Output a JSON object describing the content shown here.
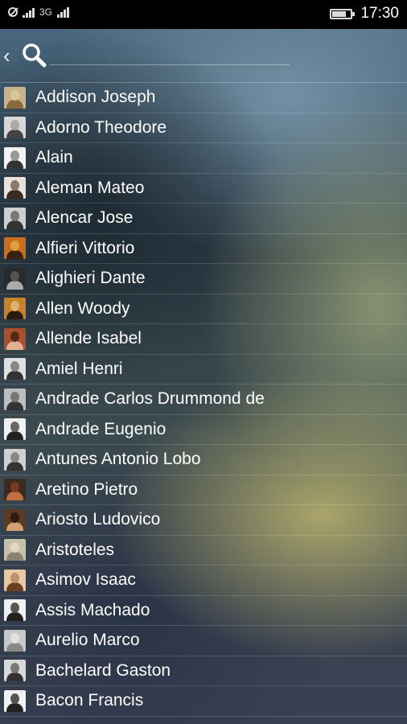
{
  "statusbar": {
    "network": "3G",
    "time": "17:30",
    "icons": [
      "no-sim-icon",
      "signal-icon",
      "network-3g-icon",
      "battery-icon"
    ]
  },
  "search": {
    "value": "",
    "placeholder": "",
    "icons": [
      "back-arrow-icon",
      "search-icon"
    ]
  },
  "list": {
    "items": [
      {
        "name": "Addison Joseph",
        "avatar_colors": [
          "#c9b38a",
          "#8a6a3a",
          "#d9c79c"
        ]
      },
      {
        "name": "Adorno Theodore",
        "avatar_colors": [
          "#d8d8d8",
          "#444444",
          "#aaaaaa"
        ]
      },
      {
        "name": "Alain",
        "avatar_colors": [
          "#f2f2f2",
          "#333333",
          "#999999"
        ]
      },
      {
        "name": "Aleman Mateo",
        "avatar_colors": [
          "#e8e2d8",
          "#3a2a20",
          "#8a7a6a"
        ]
      },
      {
        "name": "Alencar Jose",
        "avatar_colors": [
          "#cfcfcf",
          "#333333",
          "#777777"
        ]
      },
      {
        "name": "Alfieri Vittorio",
        "avatar_colors": [
          "#c8701e",
          "#3a2010",
          "#e0a040"
        ]
      },
      {
        "name": "Alighieri Dante",
        "avatar_colors": [
          "#2a2a2a",
          "#aaaaaa",
          "#555555"
        ]
      },
      {
        "name": "Allen Woody",
        "avatar_colors": [
          "#c8822a",
          "#2a1a10",
          "#e0b070"
        ]
      },
      {
        "name": "Allende Isabel",
        "avatar_colors": [
          "#a85030",
          "#e0b090",
          "#5a2a18"
        ]
      },
      {
        "name": "Amiel Henri",
        "avatar_colors": [
          "#e0e0e0",
          "#333333",
          "#888888"
        ]
      },
      {
        "name": "Andrade Carlos Drummond de",
        "avatar_colors": [
          "#bdbdbd",
          "#333333",
          "#777777"
        ]
      },
      {
        "name": "Andrade Eugenio",
        "avatar_colors": [
          "#f0f0f0",
          "#222222",
          "#666666"
        ]
      },
      {
        "name": "Antunes Antonio Lobo",
        "avatar_colors": [
          "#d0d0d0",
          "#333333",
          "#888888"
        ]
      },
      {
        "name": "Aretino Pietro",
        "avatar_colors": [
          "#3a2a20",
          "#c07040",
          "#7a3a20"
        ]
      },
      {
        "name": "Ariosto Ludovico",
        "avatar_colors": [
          "#5a3a20",
          "#d0a070",
          "#2a1a10"
        ]
      },
      {
        "name": "Aristoteles",
        "avatar_colors": [
          "#c8c0a8",
          "#8a8270",
          "#e0d8c0"
        ]
      },
      {
        "name": "Asimov Isaac",
        "avatar_colors": [
          "#e8c8a0",
          "#6a4020",
          "#c09070"
        ]
      },
      {
        "name": "Assis Machado",
        "avatar_colors": [
          "#f0f0f0",
          "#222222",
          "#555555"
        ]
      },
      {
        "name": "Aurelio Marco",
        "avatar_colors": [
          "#c8c8c8",
          "#888888",
          "#e0e0e0"
        ]
      },
      {
        "name": "Bachelard Gaston",
        "avatar_colors": [
          "#d8d8d8",
          "#333333",
          "#777777"
        ]
      },
      {
        "name": "Bacon Francis",
        "avatar_colors": [
          "#f2f2f2",
          "#222222",
          "#555555"
        ]
      }
    ]
  }
}
